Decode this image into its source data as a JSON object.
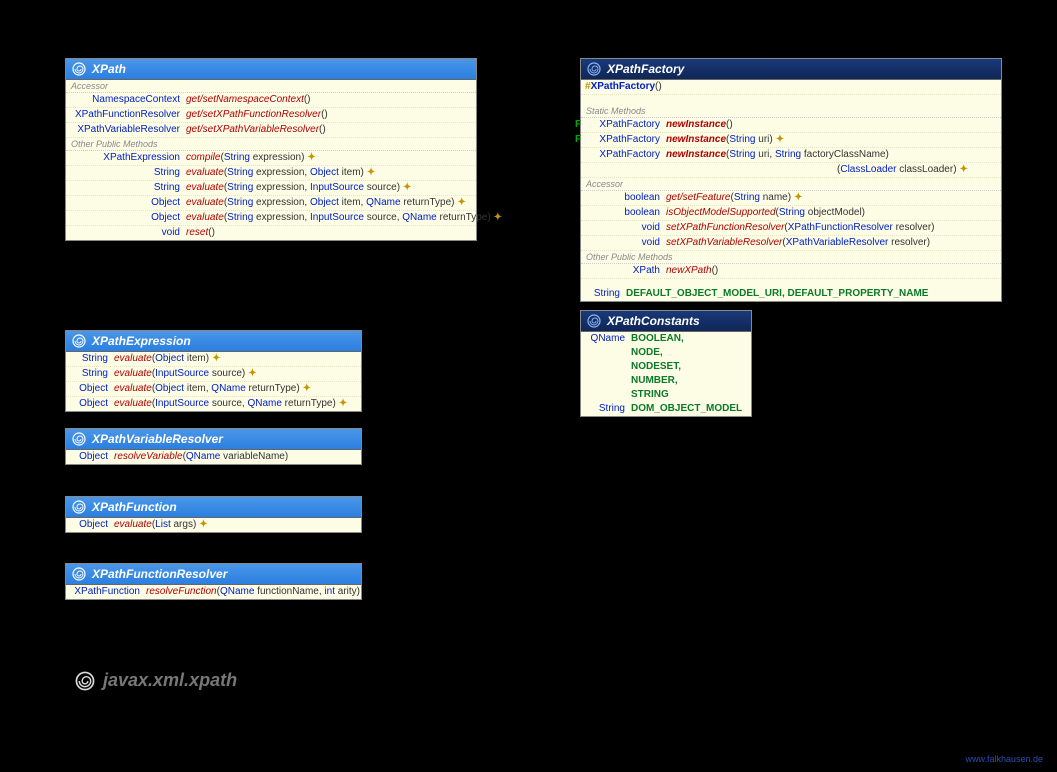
{
  "package": "javax.xml.xpath",
  "footer": "www.falkhausen.de",
  "xpath": {
    "title": "XPath",
    "sections": [
      {
        "label": "Accessor",
        "rows": [
          {
            "ret": "NamespaceContext",
            "meth": "get/setNamespaceContext",
            "params": "()"
          },
          {
            "ret": "XPathFunctionResolver",
            "meth": "get/setXPathFunctionResolver",
            "params": "()"
          },
          {
            "ret": "XPathVariableResolver",
            "meth": "get/setXPathVariableResolver",
            "params": "()"
          }
        ]
      },
      {
        "label": "Other Public Methods",
        "rows": [
          {
            "ret": "XPathExpression",
            "meth": "compile",
            "params": [
              {
                "t": "String",
                "n": "expression"
              }
            ],
            "flag": true
          },
          {
            "ret": "String",
            "meth": "evaluate",
            "params": [
              {
                "t": "String",
                "n": "expression"
              },
              {
                "t": "Object",
                "n": "item"
              }
            ],
            "flag": true
          },
          {
            "ret": "String",
            "meth": "evaluate",
            "params": [
              {
                "t": "String",
                "n": "expression"
              },
              {
                "t": "InputSource",
                "n": "source"
              }
            ],
            "flag": true
          },
          {
            "ret": "Object",
            "meth": "evaluate",
            "params": [
              {
                "t": "String",
                "n": "expression"
              },
              {
                "t": "Object",
                "n": "item"
              },
              {
                "t": "QName",
                "n": "returnType"
              }
            ],
            "flag": true
          },
          {
            "ret": "Object",
            "meth": "evaluate",
            "params": [
              {
                "t": "String",
                "n": "expression"
              },
              {
                "t": "InputSource",
                "n": "source"
              },
              {
                "t": "QName",
                "n": "returnType"
              }
            ],
            "flag": true
          },
          {
            "ret": "void",
            "meth": "reset",
            "params": "()"
          }
        ]
      }
    ]
  },
  "xpathExpression": {
    "title": "XPathExpression",
    "rows": [
      {
        "ret": "String",
        "meth": "evaluate",
        "params": [
          {
            "t": "Object",
            "n": "item"
          }
        ],
        "flag": true
      },
      {
        "ret": "String",
        "meth": "evaluate",
        "params": [
          {
            "t": "InputSource",
            "n": "source"
          }
        ],
        "flag": true
      },
      {
        "ret": "Object",
        "meth": "evaluate",
        "params": [
          {
            "t": "Object",
            "n": "item"
          },
          {
            "t": "QName",
            "n": "returnType"
          }
        ],
        "flag": true
      },
      {
        "ret": "Object",
        "meth": "evaluate",
        "params": [
          {
            "t": "InputSource",
            "n": "source"
          },
          {
            "t": "QName",
            "n": "returnType"
          }
        ],
        "flag": true
      }
    ]
  },
  "xpathVarRes": {
    "title": "XPathVariableResolver",
    "rows": [
      {
        "ret": "Object",
        "meth": "resolveVariable",
        "params": [
          {
            "t": "QName",
            "n": "variableName"
          }
        ]
      }
    ]
  },
  "xpathFunc": {
    "title": "XPathFunction",
    "rows": [
      {
        "ret": "Object",
        "meth": "evaluate",
        "params": [
          {
            "t": "List",
            "n": "args"
          }
        ],
        "flag": true
      }
    ]
  },
  "xpathFuncRes": {
    "title": "XPathFunctionResolver",
    "rows": [
      {
        "ret": "XPathFunction",
        "meth": "resolveFunction",
        "params": [
          {
            "t": "QName",
            "n": "functionName"
          },
          {
            "t": "int",
            "n": "arity"
          }
        ]
      }
    ]
  },
  "xpathFactory": {
    "title": "XPathFactory",
    "constructor": {
      "prot": "#",
      "name": "XPathFactory",
      "params": "()"
    },
    "sections": [
      {
        "label": "Static Methods",
        "rows": [
          {
            "marker": "F",
            "ret": "XPathFactory",
            "meth": "newInstance",
            "bold": true,
            "params": "()"
          },
          {
            "marker": "F",
            "ret": "XPathFactory",
            "meth": "newInstance",
            "bold": true,
            "params": [
              {
                "t": "String",
                "n": "uri"
              }
            ],
            "flag": true
          },
          {
            "ret": "XPathFactory",
            "meth": "newInstance",
            "bold": true,
            "params": [
              {
                "t": "String",
                "n": "uri"
              },
              {
                "t": "String",
                "n": "factoryClassName"
              }
            ],
            "cont": true
          },
          {
            "ret": "",
            "meth": "",
            "params": [
              {
                "t": "ClassLoader",
                "n": "classLoader"
              }
            ],
            "flag": true,
            "indent": true
          }
        ]
      },
      {
        "label": "Accessor",
        "rows": [
          {
            "ret": "boolean",
            "meth": "get/setFeature",
            "params": [
              {
                "t": "String",
                "n": "name"
              }
            ],
            "flag": true
          },
          {
            "ret": "boolean",
            "meth": "isObjectModelSupported",
            "params": [
              {
                "t": "String",
                "n": "objectModel"
              }
            ]
          },
          {
            "ret": "void",
            "meth": "setXPathFunctionResolver",
            "params": [
              {
                "t": "XPathFunctionResolver",
                "n": "resolver"
              }
            ]
          },
          {
            "ret": "void",
            "meth": "setXPathVariableResolver",
            "params": [
              {
                "t": "XPathVariableResolver",
                "n": "resolver"
              }
            ]
          }
        ]
      },
      {
        "label": "Other Public Methods",
        "rows": [
          {
            "ret": "XPath",
            "meth": "newXPath",
            "params": "()"
          }
        ]
      }
    ],
    "constants": {
      "ret": "String",
      "vals": "DEFAULT_OBJECT_MODEL_URI, DEFAULT_PROPERTY_NAME"
    }
  },
  "xpathConstants": {
    "title": "XPathConstants",
    "rows": [
      {
        "ret": "QName",
        "vals": [
          "BOOLEAN,",
          "NODE,",
          "NODESET,",
          "NUMBER,",
          "STRING"
        ]
      },
      {
        "ret": "String",
        "vals": [
          "DOM_OBJECT_MODEL"
        ]
      }
    ]
  }
}
